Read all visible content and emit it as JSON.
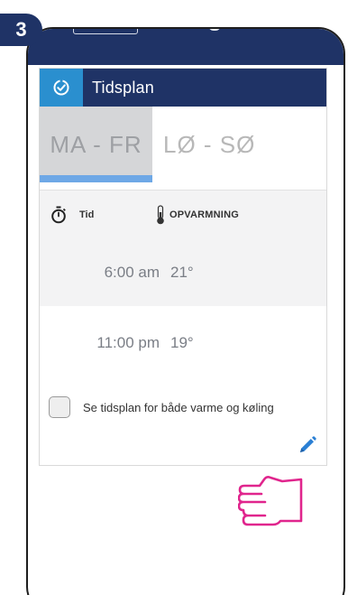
{
  "step": {
    "number": "3"
  },
  "header": {
    "title": "Tidsplan",
    "icon": "schedule-check-icon"
  },
  "tabs": [
    {
      "label": "MA - FR",
      "active": true
    },
    {
      "label": "LØ - SØ",
      "active": false
    }
  ],
  "columns": {
    "time_label": "Tid",
    "heating_label": "OPVARMNING"
  },
  "rows": [
    {
      "time": "6:00 am",
      "temp": "21°"
    },
    {
      "time": "11:00 pm",
      "temp": "19°"
    }
  ],
  "options": {
    "checkbox_label": "Se tidsplan for både varme og køling",
    "checked": false
  },
  "colors": {
    "navy": "#1f3366",
    "blue": "#2a8fcf",
    "tab_underline": "#6ea8e6",
    "hand": "#e0258d"
  },
  "icons": {
    "timer": "stopwatch-icon",
    "thermometer": "thermometer-icon",
    "edit": "pencil-icon",
    "hand": "pointing-hand-icon"
  }
}
